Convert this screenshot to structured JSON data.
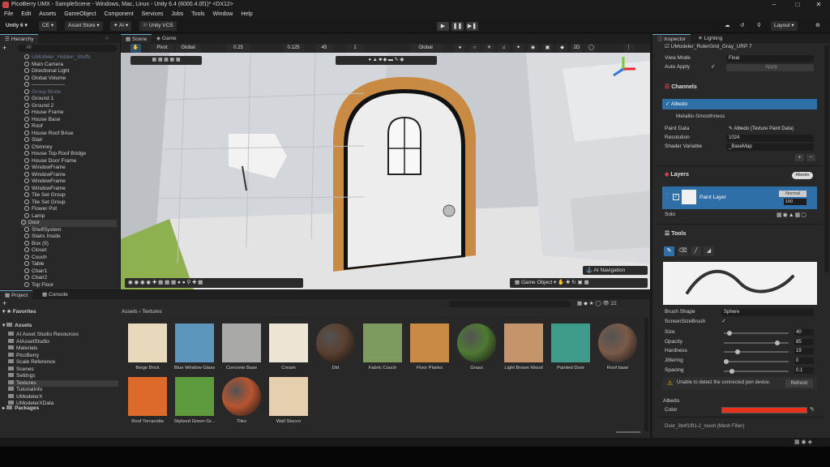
{
  "window": {
    "title": "PicoBerry UMX - SampleScene - Windows, Mac, Linux - Unity 6.4 (6000.4.0f1)* <DX12>"
  },
  "menu": [
    "File",
    "Edit",
    "Assets",
    "GameObject",
    "Component",
    "Services",
    "Jobs",
    "Tools",
    "Window",
    "Help"
  ],
  "toolbar": {
    "account": "Unity 6",
    "ce": "CE",
    "asset_store": "Asset Store",
    "ai": "AI",
    "vcs": "Unity VCS",
    "layout": "Layout"
  },
  "hierarchy": {
    "tab": "Hierarchy",
    "search_placeholder": "All",
    "items": [
      {
        "label": "UModeler_Hidden_Stuffs",
        "dim": true
      },
      {
        "label": "Main Camera"
      },
      {
        "label": "Directional Light"
      },
      {
        "label": "Global Volume"
      },
      {
        "label": "-------------------"
      },
      {
        "label": "Group Mode",
        "dim": true
      },
      {
        "label": "Ground 1"
      },
      {
        "label": "Ground 2"
      },
      {
        "label": "House Frame"
      },
      {
        "label": "House Base"
      },
      {
        "label": "Roof"
      },
      {
        "label": "House Roof BAse"
      },
      {
        "label": "Stair"
      },
      {
        "label": "Chimney"
      },
      {
        "label": "House Top Roof Bridge"
      },
      {
        "label": "House Door Frame"
      },
      {
        "label": "WindowFrame"
      },
      {
        "label": "WindowFrame"
      },
      {
        "label": "WindowFrame"
      },
      {
        "label": "WindowFrame"
      },
      {
        "label": "Tile Set Group"
      },
      {
        "label": "Tile Set Group"
      },
      {
        "label": "Flower Pot"
      },
      {
        "label": "Lamp"
      },
      {
        "label": "Door",
        "selected": true
      },
      {
        "label": "ShelfSystem"
      },
      {
        "label": "Stairs Inside"
      },
      {
        "label": "Box (9)"
      },
      {
        "label": "Closet"
      },
      {
        "label": "Couch"
      },
      {
        "label": "Table"
      },
      {
        "label": "Chair1"
      },
      {
        "label": "Chair2"
      },
      {
        "label": "Top Floor"
      }
    ]
  },
  "scene": {
    "tabs": [
      "Scene",
      "Game"
    ],
    "pivot": "Pivot",
    "global": "Global",
    "snap": "0.25",
    "snap2": "0.125",
    "angle": "45",
    "scale": "1",
    "space": "Global",
    "ai_navigation": "AI Navigation",
    "game_object": "Game Object"
  },
  "project": {
    "tabs": [
      "Project",
      "Console"
    ],
    "favorites": "Favorites",
    "assets_root": "Assets",
    "folders": [
      "AI Asset Studio Resources",
      "AIAssetStudio",
      "Materials",
      "PicoBerry",
      "Scale Reference",
      "Scenes",
      "Settings",
      "Textures",
      "TutorialInfo",
      "UModelerX",
      "UModelerXData"
    ],
    "packages": "Packages",
    "breadcrumb": [
      "Assets",
      "Textures"
    ],
    "count": "22",
    "assets": [
      {
        "label": "Beige Brick",
        "color": "#e8d9bd"
      },
      {
        "label": "Blue Window Glass",
        "color": "#5d95bd"
      },
      {
        "label": "Concrete Base",
        "color": "#a9a9a7"
      },
      {
        "label": "Cream",
        "color": "#ece5d5"
      },
      {
        "label": "Dirt",
        "color": "#5a4030",
        "sphere": true
      },
      {
        "label": "Fabric Couch",
        "color": "#7f9a5f"
      },
      {
        "label": "Floor Planks",
        "color": "#c98a44"
      },
      {
        "label": "Grass",
        "color": "#4f7a33",
        "sphere": true
      },
      {
        "label": "Light Brown Wood",
        "color": "#c4956a"
      },
      {
        "label": "Painted Door",
        "color": "#3f9c8a"
      },
      {
        "label": "Roof base",
        "color": "#7a5a48",
        "sphere": true
      },
      {
        "label": "Roof Terracotta",
        "color": "#dd6a2b"
      },
      {
        "label": "Stylized Green Gr...",
        "color": "#5e9a3e"
      },
      {
        "label": "Tiles",
        "color": "#b85530",
        "sphere": true
      },
      {
        "label": "Wall Stucco",
        "color": "#e5cfae"
      }
    ]
  },
  "inspector": {
    "tabs": [
      "Inspector",
      "Lighting"
    ],
    "material": "UModeler_RulerGrid_Gray_URP 7",
    "view_mode_label": "View Mode",
    "view_mode": "Final",
    "auto_apply": "Auto Apply",
    "apply": "Apply",
    "channels_header": "Channels",
    "channels": [
      "Albedo",
      "Metallic-Smoothness"
    ],
    "paint_data_label": "Paint Data",
    "paint_data": "Albedo (Texture Paint Data)",
    "resolution_label": "Resolution",
    "resolution": "1024",
    "shader_var_label": "Shader Variable",
    "shader_var": "_BaseMap",
    "layers_header": "Layers",
    "layers_badge": "Albedo",
    "layer_name": "Paint Layer",
    "blend": "Normal",
    "opacity_layer": "100",
    "solo": "Solo",
    "tools_header": "Tools",
    "brush_shape_label": "Brush Shape",
    "brush_shape": "Sphere",
    "screen_size_label": "ScreenSizeBrush",
    "props": [
      {
        "label": "Size",
        "value": "40",
        "frac": 0.05
      },
      {
        "label": "Opacity",
        "value": "85",
        "frac": 0.85
      },
      {
        "label": "Hardness",
        "value": "19",
        "frac": 0.19
      },
      {
        "label": "Jittering",
        "value": "0",
        "frac": 0.0
      },
      {
        "label": "Spacing",
        "value": "0.1",
        "frac": 0.1
      }
    ],
    "warning": "Unable to detect the connected pen device.",
    "refresh": "Refresh",
    "albedo_label": "Albedo",
    "color_label": "Color",
    "color_value": "#e8321e",
    "footer": "Door_3b4f1f81-2_mesh (Mesh Filter)"
  },
  "colors": {
    "accent": "#2f6fa8",
    "selection": "#3b3b3b"
  }
}
